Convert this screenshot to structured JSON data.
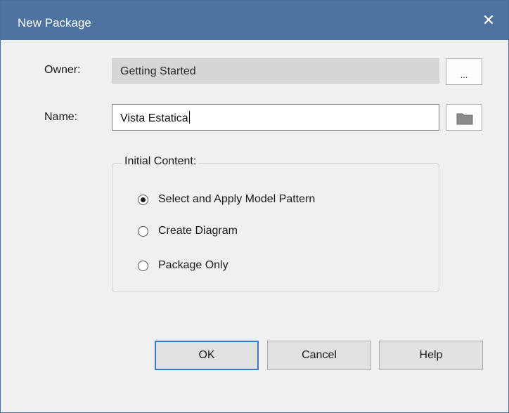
{
  "dialog": {
    "title": "New Package",
    "close_glyph": "✕"
  },
  "form": {
    "owner_label": "Owner:",
    "owner_value": "Getting Started",
    "browse_owner_label": "...",
    "name_label": "Name:",
    "name_value": "Vista Estatica",
    "folder_icon": "folder-icon"
  },
  "initial_content": {
    "legend": "Initial Content:",
    "options": [
      {
        "label": "Select and Apply Model Pattern",
        "checked": true
      },
      {
        "label": "Create Diagram",
        "checked": false
      },
      {
        "label": "Package Only",
        "checked": false
      }
    ]
  },
  "buttons": {
    "ok": "OK",
    "cancel": "Cancel",
    "help": "Help"
  },
  "colors": {
    "titlebar": "#4e73a0",
    "dialog_bg": "#f0f0f0",
    "default_button_border": "#3a78c9"
  }
}
